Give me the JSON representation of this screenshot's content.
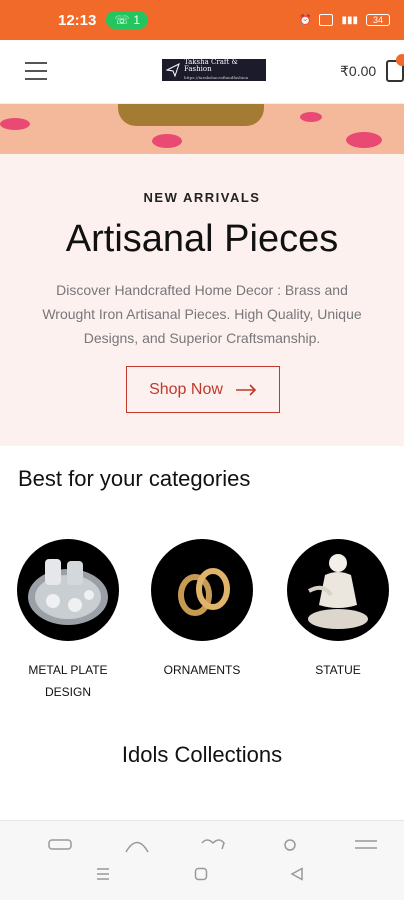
{
  "status_bar": {
    "time": "12:13",
    "notification_count": "1",
    "battery": "34"
  },
  "header": {
    "logo_title": "Taksha Craft & Fashion",
    "logo_subtitle": "https://tarakshacraftandfashion",
    "cart_total": "₹0.00"
  },
  "hero": {
    "kicker": "NEW ARRIVALS",
    "title": "Artisanal Pieces",
    "description": "Discover Handcrafted Home Decor : Brass and Wrought Iron Artisanal Pieces. High Quality, Unique Designs, and Superior Craftsmanship.",
    "cta_label": "Shop Now"
  },
  "categories": {
    "heading": "Best for your categories",
    "items": [
      {
        "label": "METAL PLATE DESIGN"
      },
      {
        "label": "ORNAMENTS"
      },
      {
        "label": "STATUE"
      }
    ]
  },
  "collections": {
    "heading": "Idols Collections"
  },
  "icons": {
    "menu": "hamburger-menu-icon",
    "cart": "shopping-bag-icon",
    "arrow": "arrow-right-icon"
  },
  "colors": {
    "status_bar": "#f26a2a",
    "accent": "#c0392b",
    "hero_bg": "#fdf1f0"
  }
}
